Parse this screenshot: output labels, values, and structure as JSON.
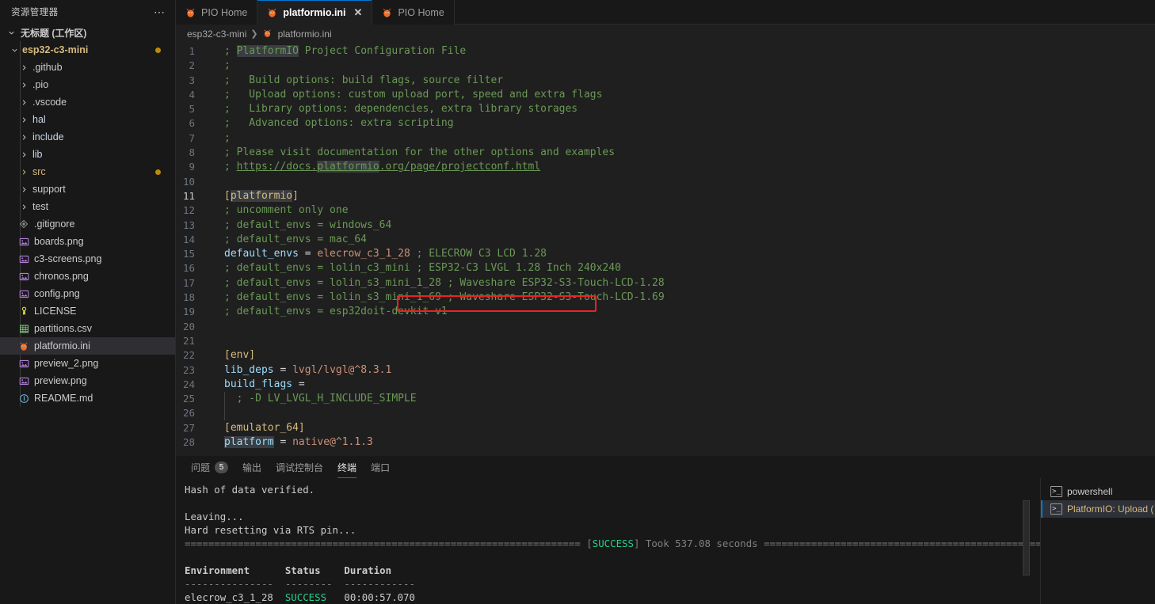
{
  "sidebar": {
    "title": "资源管理器",
    "actions_icon": "ellipsis-icon",
    "workspace": "无标题 (工作区)",
    "project": "esp32-c3-mini",
    "folders": [
      {
        "label": ".github"
      },
      {
        "label": ".pio"
      },
      {
        "label": ".vscode"
      },
      {
        "label": "hal"
      },
      {
        "label": "include"
      },
      {
        "label": "lib"
      },
      {
        "label": "src",
        "modified": true
      },
      {
        "label": "support"
      },
      {
        "label": "test"
      }
    ],
    "files": [
      {
        "label": ".gitignore",
        "icon": "gitignore-icon"
      },
      {
        "label": "boards.png",
        "icon": "image-icon"
      },
      {
        "label": "c3-screens.png",
        "icon": "image-icon"
      },
      {
        "label": "chronos.png",
        "icon": "image-icon"
      },
      {
        "label": "config.png",
        "icon": "image-icon"
      },
      {
        "label": "LICENSE",
        "icon": "license-icon"
      },
      {
        "label": "partitions.csv",
        "icon": "csv-icon"
      },
      {
        "label": "platformio.ini",
        "icon": "platformio-icon",
        "selected": true
      },
      {
        "label": "preview_2.png",
        "icon": "image-icon"
      },
      {
        "label": "preview.png",
        "icon": "image-icon"
      },
      {
        "label": "README.md",
        "icon": "info-icon"
      }
    ]
  },
  "tabs": [
    {
      "label": "PIO Home",
      "icon": "platformio-icon",
      "active": false,
      "closable": false
    },
    {
      "label": "platformio.ini",
      "icon": "platformio-icon",
      "active": true,
      "closable": true,
      "close_glyph": "✕"
    },
    {
      "label": "PIO Home",
      "icon": "platformio-icon",
      "active": false,
      "closable": false
    }
  ],
  "breadcrumb": {
    "project": "esp32-c3-mini",
    "separator": "❯",
    "file": "platformio.ini",
    "file_icon": "platformio-icon"
  },
  "editor": {
    "language": "ini",
    "highlight_box_line": 15,
    "lines": [
      {
        "n": 1,
        "segments": [
          {
            "t": "; ",
            "c": "cm"
          },
          {
            "t": "PlatformIO",
            "c": "cm hl"
          },
          {
            "t": " Project Configuration File",
            "c": "cm"
          }
        ]
      },
      {
        "n": 2,
        "segments": [
          {
            "t": ";",
            "c": "cm"
          }
        ]
      },
      {
        "n": 3,
        "segments": [
          {
            "t": ";   Build options: build flags, source filter",
            "c": "cm"
          }
        ]
      },
      {
        "n": 4,
        "segments": [
          {
            "t": ";   Upload options: custom upload port, speed and extra flags",
            "c": "cm"
          }
        ]
      },
      {
        "n": 5,
        "segments": [
          {
            "t": ";   Library options: dependencies, extra library storages",
            "c": "cm"
          }
        ]
      },
      {
        "n": 6,
        "segments": [
          {
            "t": ";   Advanced options: extra scripting",
            "c": "cm"
          }
        ]
      },
      {
        "n": 7,
        "segments": [
          {
            "t": ";",
            "c": "cm"
          }
        ]
      },
      {
        "n": 8,
        "segments": [
          {
            "t": "; Please visit documentation for the other options and examples",
            "c": "cm"
          }
        ]
      },
      {
        "n": 9,
        "segments": [
          {
            "t": "; ",
            "c": "cm"
          },
          {
            "t": "https://docs.",
            "c": "cm link"
          },
          {
            "t": "platformio",
            "c": "cm link hl"
          },
          {
            "t": ".org/page/projectconf.html",
            "c": "cm link"
          }
        ]
      },
      {
        "n": 10,
        "segments": []
      },
      {
        "n": 11,
        "current": true,
        "segments": [
          {
            "t": "[",
            "c": "sec"
          },
          {
            "t": "platformio",
            "c": "sec hl"
          },
          {
            "t": "]",
            "c": "sec"
          }
        ]
      },
      {
        "n": 12,
        "segments": [
          {
            "t": "; uncomment only one",
            "c": "cm"
          }
        ]
      },
      {
        "n": 13,
        "segments": [
          {
            "t": "; default_envs = windows_64",
            "c": "cm"
          }
        ]
      },
      {
        "n": 14,
        "segments": [
          {
            "t": "; default_envs = mac_64",
            "c": "cm"
          }
        ]
      },
      {
        "n": 15,
        "segments": [
          {
            "t": "default_envs",
            "c": "key"
          },
          {
            "t": " = ",
            "c": "eq"
          },
          {
            "t": "elecrow_c3_1_28",
            "c": "val"
          },
          {
            "t": " ; ELECROW C3 LCD 1.28",
            "c": "cm"
          }
        ]
      },
      {
        "n": 16,
        "segments": [
          {
            "t": "; default_envs = lolin_c3_mini ; ESP32-C3 LVGL 1.28 Inch 240x240",
            "c": "cm"
          }
        ]
      },
      {
        "n": 17,
        "segments": [
          {
            "t": "; default_envs = lolin_s3_mini_1_28 ; Waveshare ESP32-S3-Touch-LCD-1.28",
            "c": "cm"
          }
        ]
      },
      {
        "n": 18,
        "segments": [
          {
            "t": "; default_envs = lolin_s3_mini_1_69 ; Waveshare ESP32-S3-Touch-LCD-1.69",
            "c": "cm"
          }
        ]
      },
      {
        "n": 19,
        "segments": [
          {
            "t": "; default_envs = esp32doit-devkit-v1",
            "c": "cm"
          }
        ]
      },
      {
        "n": 20,
        "segments": []
      },
      {
        "n": 21,
        "segments": []
      },
      {
        "n": 22,
        "segments": [
          {
            "t": "[env]",
            "c": "sec"
          }
        ]
      },
      {
        "n": 23,
        "segments": [
          {
            "t": "lib_deps",
            "c": "key"
          },
          {
            "t": " = ",
            "c": "eq"
          },
          {
            "t": "lvgl/lvgl@^8.3.1",
            "c": "val"
          }
        ]
      },
      {
        "n": 24,
        "segments": [
          {
            "t": "build_flags",
            "c": "key"
          },
          {
            "t": " =",
            "c": "eq"
          }
        ]
      },
      {
        "n": 25,
        "guide": true,
        "segments": [
          {
            "t": "  ; -D LV_LVGL_H_INCLUDE_SIMPLE",
            "c": "cm"
          }
        ]
      },
      {
        "n": 26,
        "guide": true,
        "segments": []
      },
      {
        "n": 27,
        "segments": [
          {
            "t": "[emulator_64]",
            "c": "sec"
          }
        ]
      },
      {
        "n": 28,
        "segments": [
          {
            "t": "platform",
            "c": "key hl"
          },
          {
            "t": " = ",
            "c": "eq"
          },
          {
            "t": "native@^1.1.3",
            "c": "val"
          }
        ]
      }
    ]
  },
  "panel": {
    "tabs": [
      {
        "label": "问题",
        "badge": "5",
        "active": false
      },
      {
        "label": "输出",
        "active": false
      },
      {
        "label": "调试控制台",
        "active": false
      },
      {
        "label": "终端",
        "active": true
      },
      {
        "label": "端口",
        "active": false
      }
    ],
    "terminal_lines": [
      [
        {
          "t": "Hash of data verified."
        }
      ],
      [],
      [
        {
          "t": "Leaving..."
        }
      ],
      [
        {
          "t": "Hard resetting via RTS pin..."
        }
      ],
      [
        {
          "t": "=================================================================== ",
          "c": "dim"
        },
        {
          "t": "[",
          "c": "dim"
        },
        {
          "t": "SUCCESS",
          "c": "ok"
        },
        {
          "t": "] Took 537.08 seconds ===============================================================",
          "c": "dim"
        }
      ],
      [],
      [
        {
          "t": "Environment      Status    Duration",
          "c": "bold"
        }
      ],
      [
        {
          "t": "---------------  --------  ------------",
          "c": "dim"
        }
      ],
      [
        {
          "t": "elecrow_c3_1_28  ",
          "c": ""
        },
        {
          "t": "SUCCESS",
          "c": "ok"
        },
        {
          "t": "   00:00:57.070"
        }
      ]
    ],
    "terminal_list": [
      {
        "label": "powershell",
        "icon": "terminal-icon",
        "active": false
      },
      {
        "label": "PlatformIO: Upload (",
        "icon": "terminal-icon",
        "active": true
      }
    ]
  }
}
